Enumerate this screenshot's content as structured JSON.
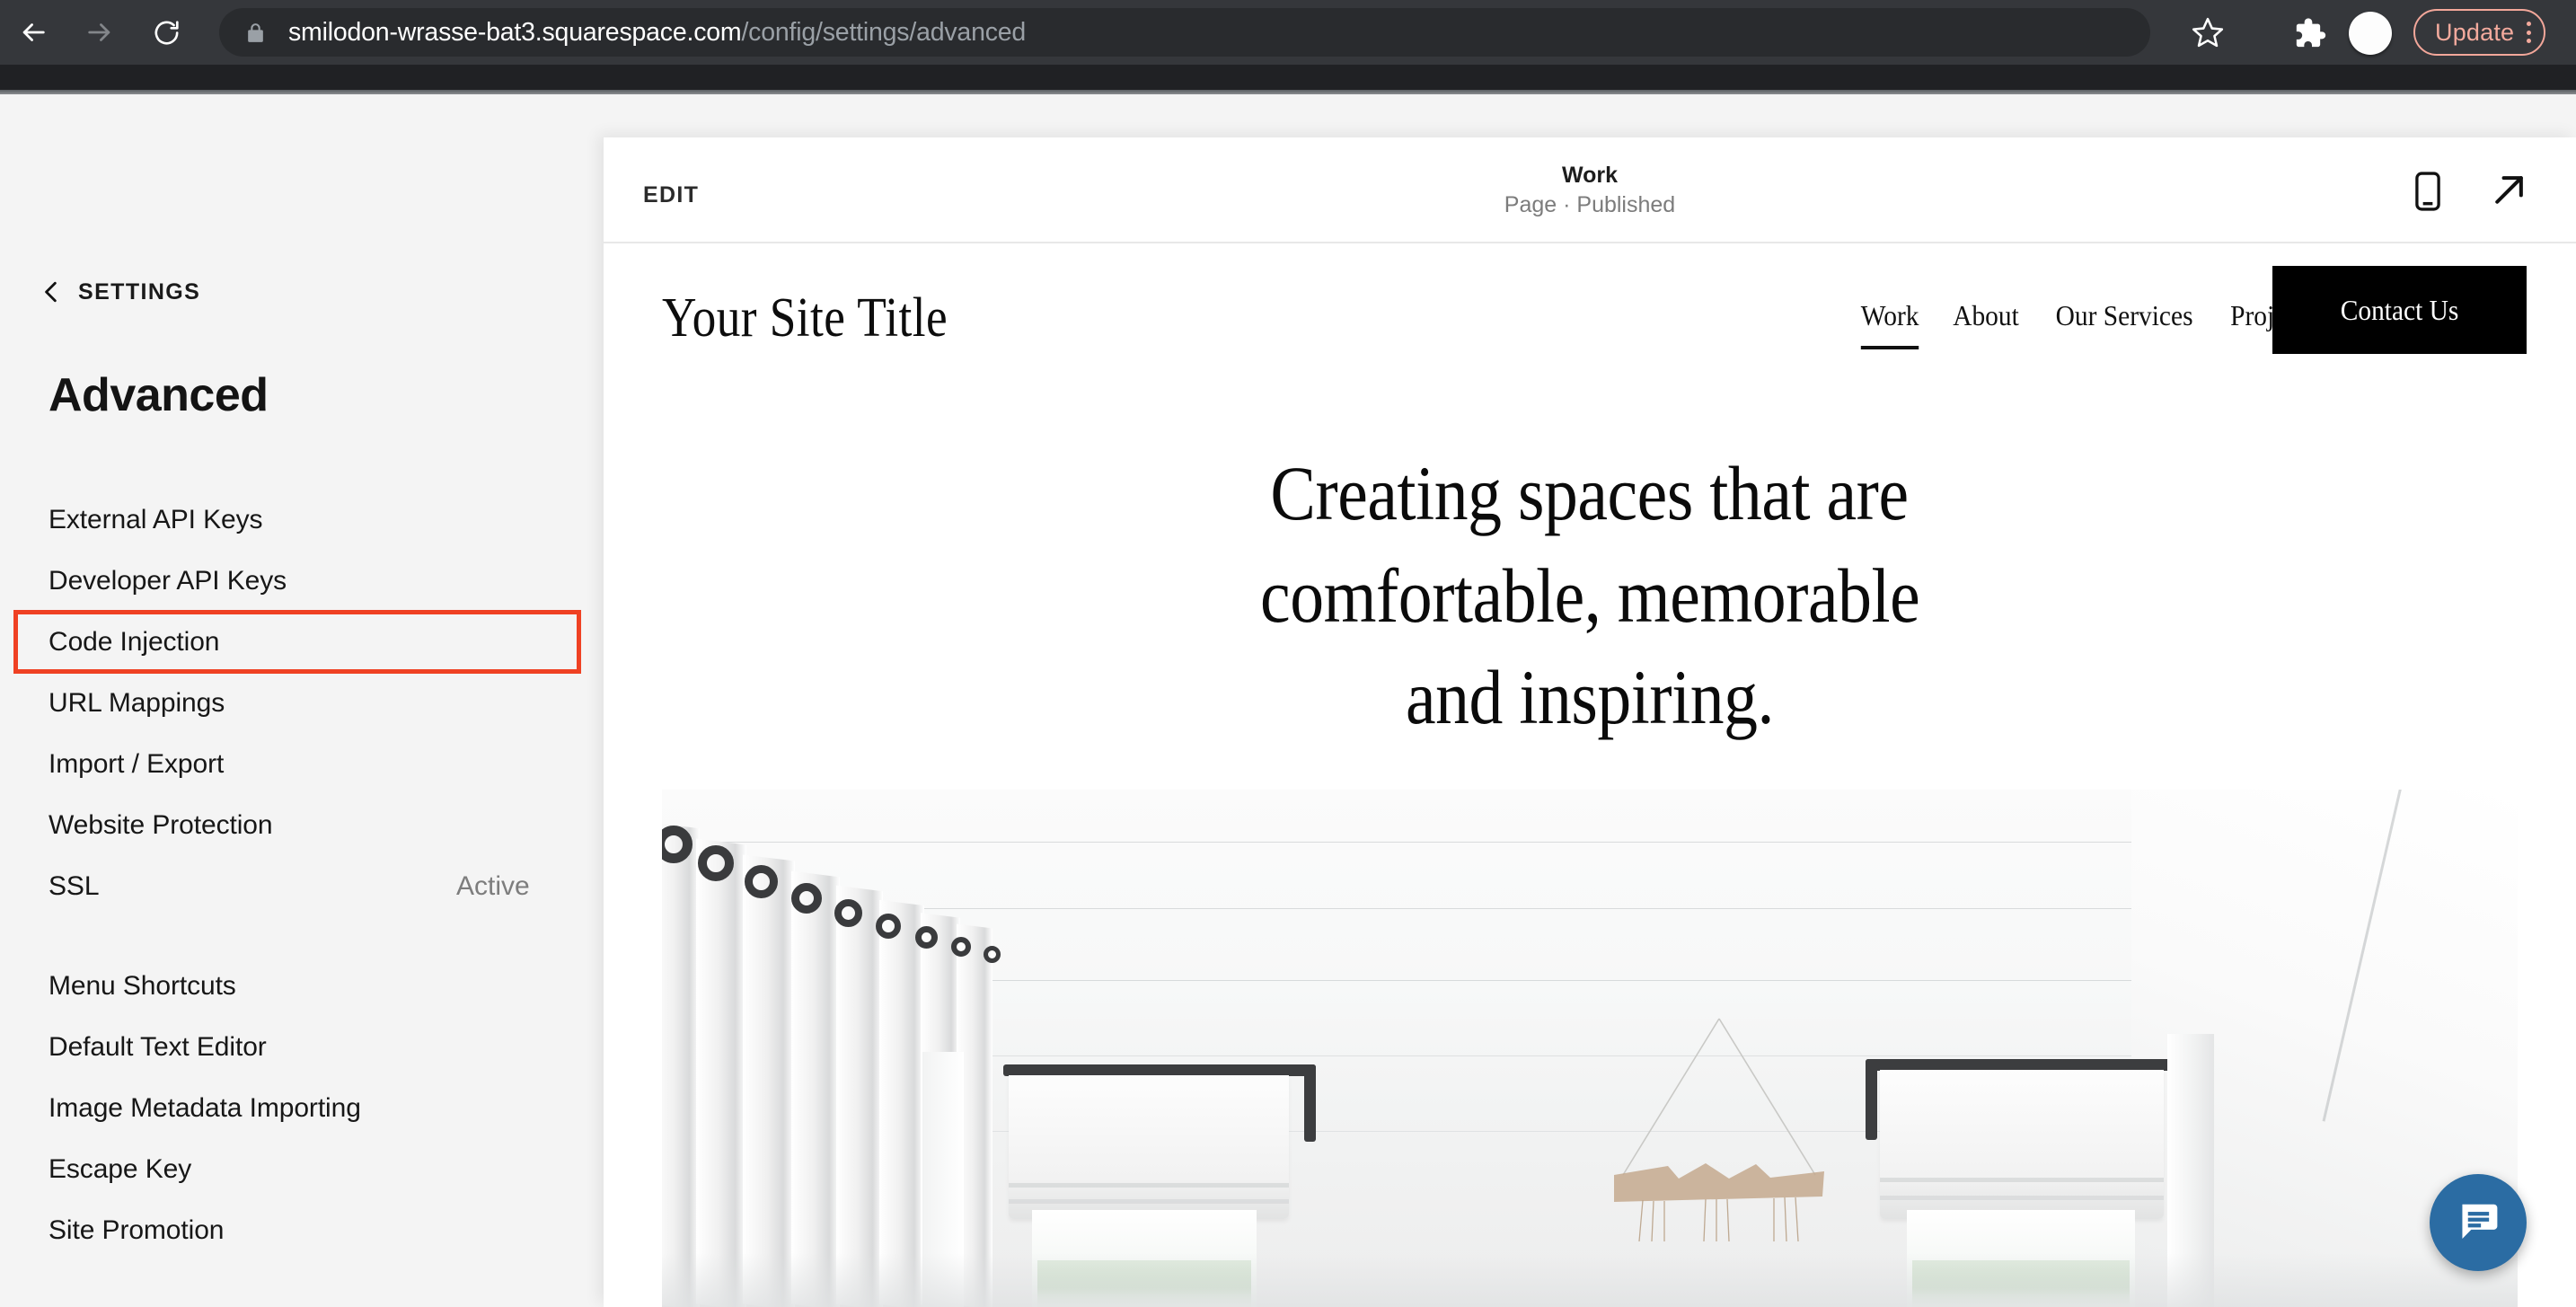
{
  "browser": {
    "back_icon": "arrow-left-icon",
    "forward_icon": "arrow-right-icon",
    "reload_icon": "reload-icon",
    "lock_icon": "lock-icon",
    "url_domain": "smilodon-wrasse-bat3.squarespace.com",
    "url_path": "/config/settings/advanced",
    "star_icon": "star-outline-icon",
    "extensions_icon": "puzzle-piece-icon",
    "avatar": "profile-avatar",
    "update_label": "Update",
    "kebab_icon": "three-dot-menu-icon",
    "accent_update": "#f3aa9d",
    "toolbar_bg": "#35373b",
    "omnibox_bg": "#292b2e"
  },
  "sidebar": {
    "back_label": "SETTINGS",
    "back_icon": "chevron-left-icon",
    "title": "Advanced",
    "highlight_color": "#ef4123",
    "highlighted_item": "Code Injection",
    "group_one": [
      {
        "label": "External API Keys",
        "value": ""
      },
      {
        "label": "Developer API Keys",
        "value": ""
      },
      {
        "label": "Code Injection",
        "value": ""
      },
      {
        "label": "URL Mappings",
        "value": ""
      },
      {
        "label": "Import / Export",
        "value": ""
      },
      {
        "label": "Website Protection",
        "value": ""
      },
      {
        "label": "SSL",
        "value": "Active"
      }
    ],
    "group_two": [
      {
        "label": "Menu Shortcuts",
        "value": ""
      },
      {
        "label": "Default Text Editor",
        "value": ""
      },
      {
        "label": "Image Metadata Importing",
        "value": ""
      },
      {
        "label": "Escape Key",
        "value": ""
      },
      {
        "label": "Site Promotion",
        "value": ""
      }
    ]
  },
  "preview_bar": {
    "edit_label": "EDIT",
    "page_title": "Work",
    "page_status": "Page · Published",
    "mobile_icon": "mobile-device-icon",
    "open_icon": "open-external-arrow-icon"
  },
  "site": {
    "logo": "Your Site Title",
    "nav": [
      {
        "label": "Work",
        "active": true
      },
      {
        "label": "About",
        "active": false
      },
      {
        "label": "Our Services",
        "active": false
      },
      {
        "label": "Projects",
        "active": false
      }
    ],
    "cta_label": "Contact Us",
    "cta_bg": "#000000",
    "hero_lines": [
      "Creating spaces that are",
      "comfortable, memorable",
      "and inspiring."
    ],
    "hero_image_alt": "Bright white interior room with curtains and windows"
  },
  "chat": {
    "icon": "chat-bubble-icon",
    "color": "#2b6ca3"
  }
}
